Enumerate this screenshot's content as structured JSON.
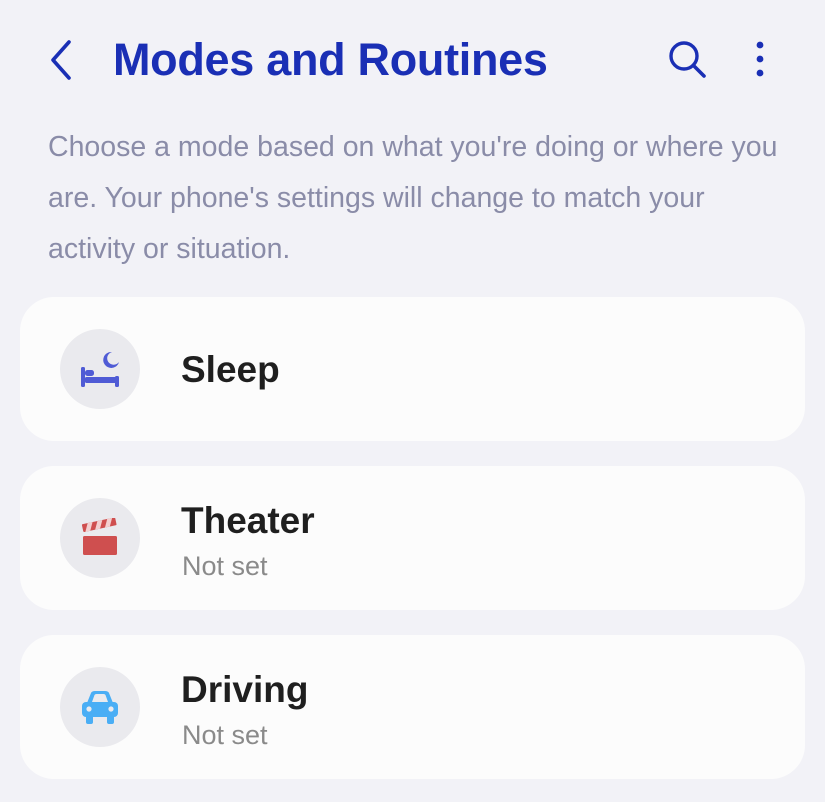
{
  "header": {
    "title": "Modes and Routines",
    "accent_color": "#1a2fb5",
    "back_icon": "chevron-left-icon",
    "search_icon": "search-icon",
    "more_icon": "more-vertical-icon"
  },
  "description": "Choose a mode based on what you're doing or where you are. Your phone's settings will change to match your activity or situation.",
  "modes": [
    {
      "label": "Sleep",
      "status": "",
      "icon": "bed-moon-icon",
      "icon_color": "#4f5bd5"
    },
    {
      "label": "Theater",
      "status": "Not set",
      "icon": "clapperboard-icon",
      "icon_color": "#cf4f4f"
    },
    {
      "label": "Driving",
      "status": "Not set",
      "icon": "car-icon",
      "icon_color": "#4aaef5"
    }
  ]
}
